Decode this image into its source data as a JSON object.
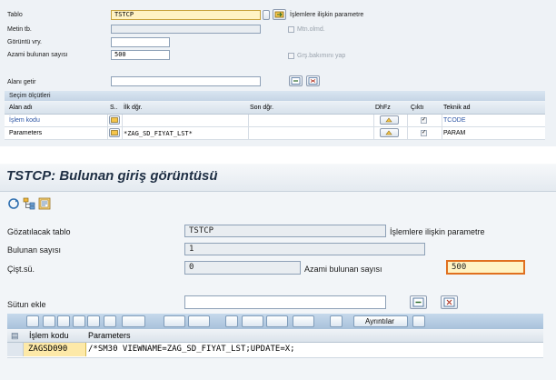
{
  "top": {
    "table_label": "Tablo",
    "table_value": "TSTCP",
    "table_param_label": "İşlemlere ilişkin parametre",
    "text_table_label": "Metin tb.",
    "text_table_checkbox_label": "Mtn.olmd.",
    "view_label": "Görüntü vry.",
    "view_value": "",
    "max_hits_label": "Azami bulunan sayısı",
    "max_hits_value": "500",
    "maint_view_label": "Grş.bakımını yap",
    "field_label": "Alanı getir",
    "field_value": "",
    "selection_header": "Seçim ölçütleri",
    "columns": [
      "Alan adı",
      "S..",
      "İlk dğr.",
      "Son dğr.",
      "DhFz",
      "Çıktı",
      "Teknik ad"
    ],
    "rows": [
      {
        "field": "İşlem kodu",
        "first": "",
        "last": "",
        "output": "✓",
        "tech": "TCODE",
        "link": true
      },
      {
        "field": "Parameters",
        "first": "*ZAG_SD_FIYAT_LST*",
        "last": "",
        "output": "✓",
        "tech": "PARAM",
        "link": false
      }
    ]
  },
  "bottom": {
    "title": "TSTCP: Bulunan giriş görüntüsü",
    "table_label": "Gözatılacak tablo",
    "table_value": "TSTCP",
    "table_desc": "İşlemlere ilişkin parametre",
    "found_label": "Bulunan sayısı",
    "found_value": "1",
    "fixed_cols_label": "Çişt.sü.",
    "fixed_cols_value": "0",
    "max_hits_label": "Azami bulunan sayısı",
    "max_hits_value": "500",
    "add_col_label": "Sütun ekle",
    "add_col_value": "",
    "details_label": "Ayrıntılar",
    "result_columns": [
      "İşlem kodu",
      "Parameters"
    ],
    "result_rows": [
      {
        "tcode": "ZAGSD090",
        "param": "/*SM30 VIEWNAME=ZAG_SD_FIYAT_LST;UPDATE=X;"
      }
    ]
  },
  "colors": {
    "link": "#2d56a5",
    "highlight_field": "#fff3c4",
    "focus_border": "#e07020",
    "title": "#1f2f44"
  }
}
